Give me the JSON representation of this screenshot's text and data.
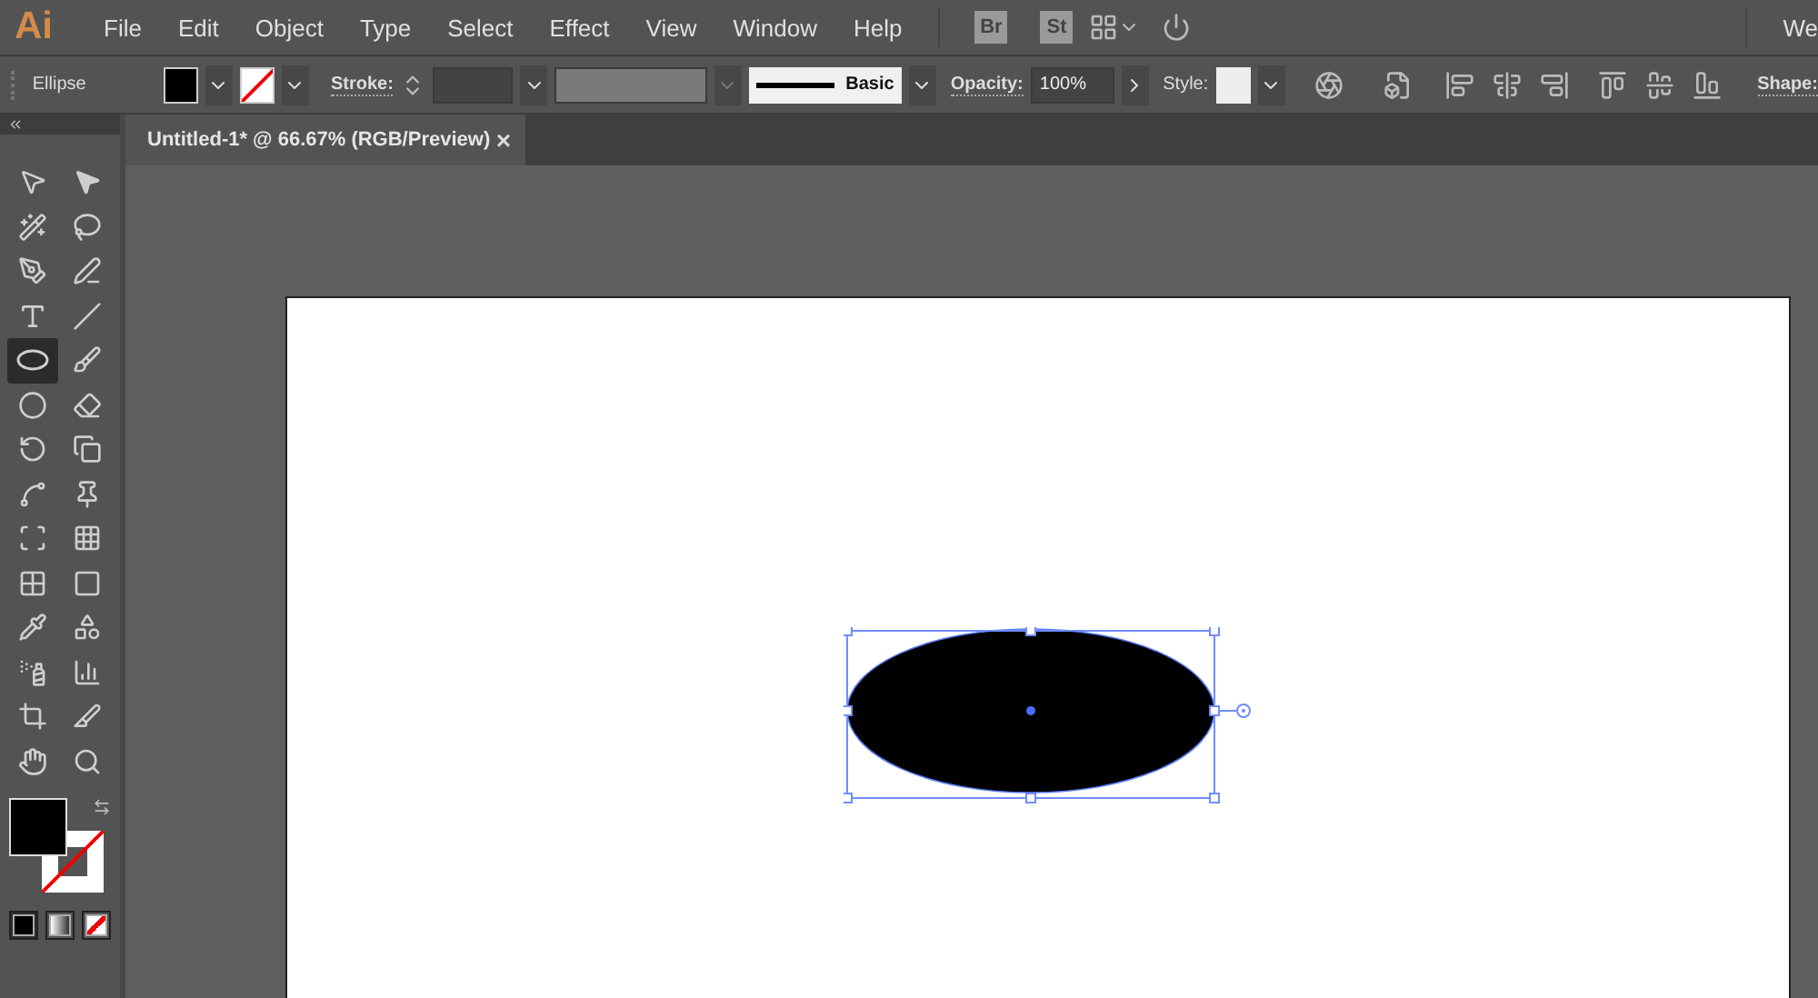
{
  "app": {
    "logo": "Ai",
    "menu": [
      "File",
      "Edit",
      "Object",
      "Type",
      "Select",
      "Effect",
      "View",
      "Window",
      "Help"
    ],
    "bridge": "Br",
    "stock": "St",
    "workspace": "We"
  },
  "control_bar": {
    "object_type": "Ellipse",
    "stroke_label": "Stroke:",
    "brush": "Basic",
    "opacity_label": "Opacity:",
    "opacity": "100%",
    "style_label": "Style:",
    "shape_label": "Shape:"
  },
  "document_tab": {
    "title": "Untitled-1* @ 66.67% (RGB/Preview)",
    "close": "×",
    "selected": true
  },
  "tools": [
    {
      "selected": false
    },
    {
      "selected": false
    },
    {
      "selected": false
    },
    {
      "selected": false
    },
    {
      "selected": false
    },
    {
      "selected": false
    },
    {
      "selected": false
    },
    {
      "selected": false
    },
    {
      "selected": true
    },
    {
      "selected": false
    },
    {
      "selected": false
    },
    {
      "selected": false
    },
    {
      "selected": false
    },
    {
      "selected": false
    },
    {
      "selected": false
    },
    {
      "selected": false
    },
    {
      "selected": false
    },
    {
      "selected": false
    },
    {
      "selected": false
    },
    {
      "selected": false
    },
    {
      "selected": false
    },
    {
      "selected": false
    },
    {
      "selected": false
    },
    {
      "selected": false
    },
    {
      "selected": false
    },
    {
      "selected": false
    },
    {
      "selected": false
    },
    {
      "selected": false
    }
  ],
  "draw_modes": [
    {
      "selected": true
    },
    {
      "selected": false
    },
    {
      "selected": false
    }
  ]
}
